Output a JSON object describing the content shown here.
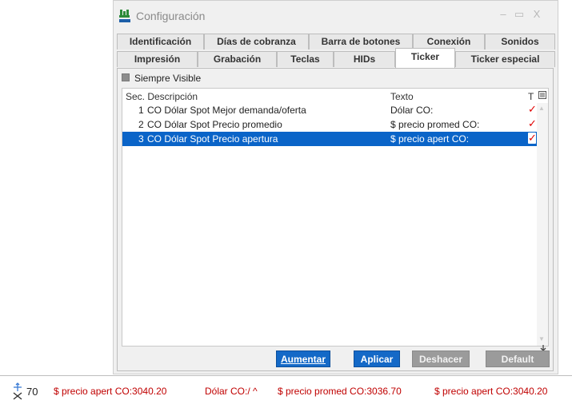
{
  "window": {
    "title": "Configuración",
    "minimize": "–",
    "maximize": "▭",
    "close": "X"
  },
  "tabs_row1": [
    {
      "label": "Identificación"
    },
    {
      "label": "Días de cobranza"
    },
    {
      "label": "Barra de botones"
    },
    {
      "label": "Conexión"
    },
    {
      "label": "Sonidos"
    }
  ],
  "tabs_row2": [
    {
      "label": "Impresión"
    },
    {
      "label": "Grabación"
    },
    {
      "label": "Teclas"
    },
    {
      "label": "HIDs"
    },
    {
      "label": "Ticker",
      "active": true
    },
    {
      "label": "Ticker especial"
    }
  ],
  "panel": {
    "always_visible_label": "Siempre Visible",
    "columns": {
      "sec_desc": "Sec. Descripción",
      "texto": "Texto",
      "t": "T"
    },
    "rows": [
      {
        "num": "1",
        "descripcion": "CO Dólar Spot Mejor demanda/oferta",
        "texto": "Dólar CO:",
        "checked": "✓",
        "selected": false
      },
      {
        "num": "2",
        "descripcion": "CO Dólar Spot Precio promedio",
        "texto": "$ precio promed CO:",
        "checked": "✓",
        "selected": false
      },
      {
        "num": "3",
        "descripcion": "CO Dólar Spot Precio apertura",
        "texto": "$ precio apert CO:",
        "checked": "✓",
        "selected": true
      }
    ]
  },
  "buttons": {
    "aumentar": "Aumentar",
    "aplicar": "Aplicar",
    "deshacer": "Deshacer",
    "default": "Default"
  },
  "status_bar": {
    "count": "70",
    "items": [
      {
        "text": "$ precio apert CO:3040.20",
        "color": "#c00000"
      },
      {
        "text": "Dólar CO:/ ^",
        "color": "#c00000"
      },
      {
        "text": "$ precio promed CO:3036.70",
        "color": "#c00000"
      },
      {
        "text": "$ precio apert CO:3040.20",
        "color": "#c00000"
      }
    ]
  },
  "colors": {
    "accent": "#1469c7",
    "selection": "#0a64c8",
    "check": "#e00000"
  }
}
